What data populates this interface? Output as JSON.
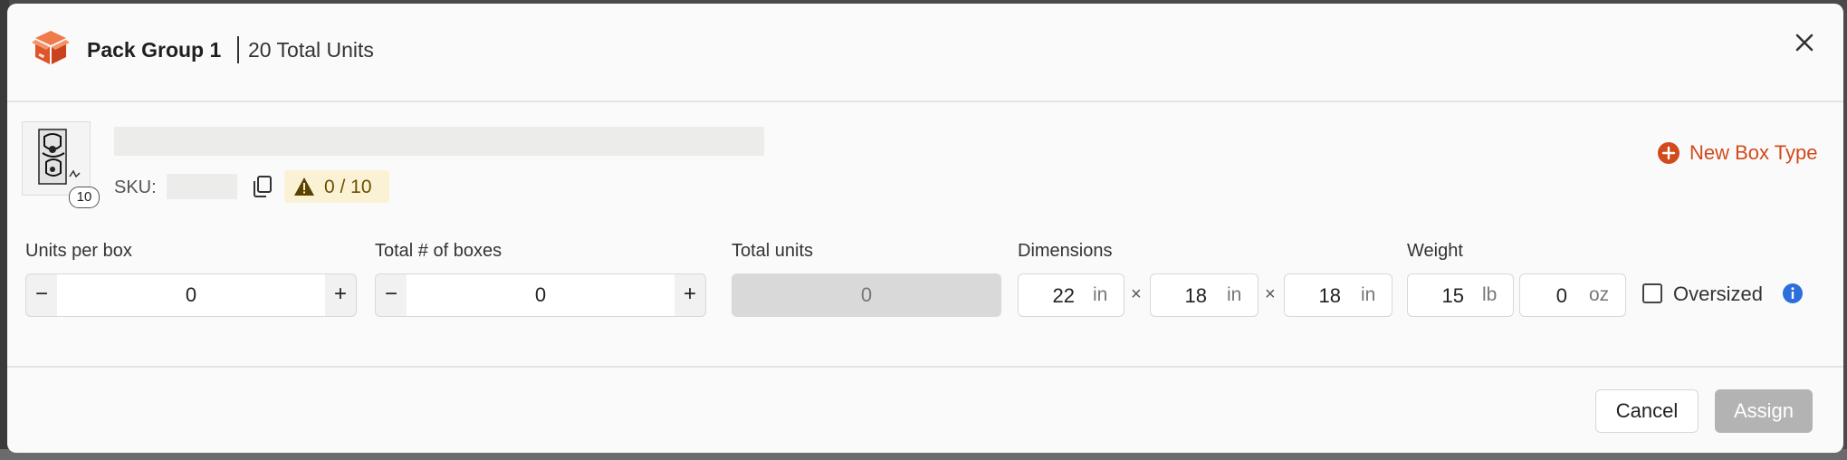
{
  "header": {
    "title": "Pack Group 1",
    "subtitle": "20 Total Units"
  },
  "product": {
    "image_quantity": "10",
    "sku_label": "SKU:",
    "progress": "0 / 10",
    "new_box_type_label": "New Box Type"
  },
  "fields": {
    "units_per_box": {
      "label": "Units per box",
      "value": "0",
      "minus": "−",
      "plus": "+"
    },
    "total_boxes": {
      "label": "Total # of boxes",
      "value": "0",
      "minus": "−",
      "plus": "+"
    },
    "total_units": {
      "label": "Total units",
      "value": "0"
    },
    "dimensions": {
      "label": "Dimensions",
      "length": "22",
      "width": "18",
      "height": "18",
      "unit": "in",
      "separator": "×"
    },
    "weight": {
      "label": "Weight",
      "lb_value": "15",
      "lb_unit": "lb",
      "oz_value": "0",
      "oz_unit": "oz"
    },
    "oversized": {
      "label": "Oversized",
      "checked": false
    }
  },
  "footer": {
    "cancel_label": "Cancel",
    "assign_label": "Assign"
  },
  "colors": {
    "brand_orange": "#e0542a",
    "link_red": "#d24a1c",
    "warning_bg": "#fbf2d6",
    "info_blue": "#2a6fdb",
    "disabled_gray": "#b3b3b3"
  }
}
